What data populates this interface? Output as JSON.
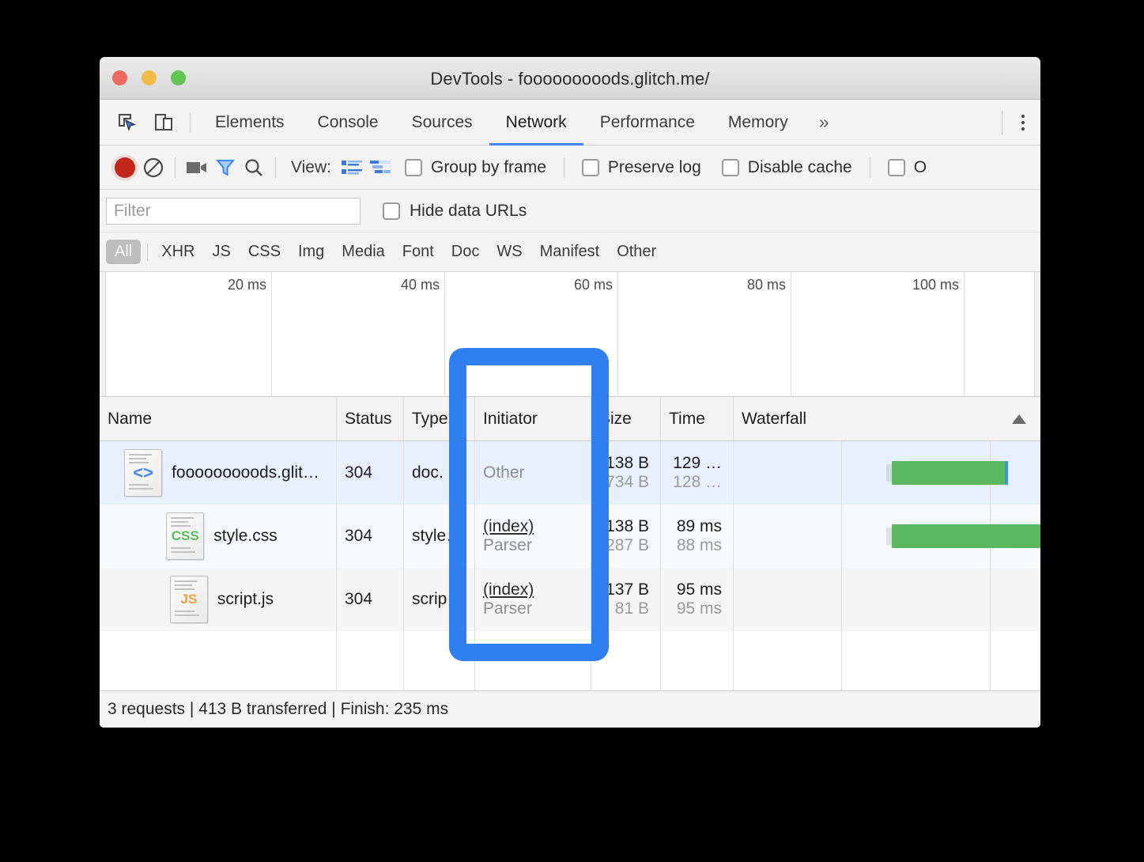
{
  "window": {
    "title": "DevTools - fooooooooods.glitch.me/",
    "traffic_lights": [
      "close",
      "minimize",
      "zoom"
    ]
  },
  "tabbar": {
    "inspect_icon": "inspect-element-icon",
    "device_icon": "device-toolbar-icon",
    "tabs": [
      {
        "label": "Elements",
        "active": false
      },
      {
        "label": "Console",
        "active": false
      },
      {
        "label": "Sources",
        "active": false
      },
      {
        "label": "Network",
        "active": true
      },
      {
        "label": "Performance",
        "active": false
      },
      {
        "label": "Memory",
        "active": false
      }
    ],
    "more_tabs": "»",
    "menu_icon": "kebab-menu-icon"
  },
  "network_toolbar": {
    "record_icon": "record-icon",
    "clear_icon": "clear-icon",
    "camera_icon": "screenshot-camera-icon",
    "filter_icon": "filter-funnel-icon",
    "search_icon": "search-icon",
    "view_label": "View:",
    "view_list_icon": "list-view-icon",
    "view_waterfall_icon": "waterfall-view-icon",
    "checkboxes": [
      {
        "label": "Group by frame",
        "checked": false
      },
      {
        "label": "Preserve log",
        "checked": false
      },
      {
        "label": "Disable cache",
        "checked": false
      },
      {
        "label": "O",
        "checked": false,
        "clipped": true
      }
    ]
  },
  "filter_bar": {
    "placeholder": "Filter",
    "value": "",
    "hide_data_urls_label": "Hide data URLs",
    "hide_data_urls_checked": false
  },
  "type_filters": [
    {
      "label": "All",
      "active": true
    },
    {
      "label": "XHR",
      "active": false
    },
    {
      "label": "JS",
      "active": false
    },
    {
      "label": "CSS",
      "active": false
    },
    {
      "label": "Img",
      "active": false
    },
    {
      "label": "Media",
      "active": false
    },
    {
      "label": "Font",
      "active": false
    },
    {
      "label": "Doc",
      "active": false
    },
    {
      "label": "WS",
      "active": false
    },
    {
      "label": "Manifest",
      "active": false
    },
    {
      "label": "Other",
      "active": false
    }
  ],
  "overview": {
    "ticks": [
      "20 ms",
      "40 ms",
      "60 ms",
      "80 ms",
      "100 ms"
    ]
  },
  "table": {
    "headers": [
      "Name",
      "Status",
      "Type",
      "Initiator",
      "Size",
      "Time",
      "Waterfall"
    ],
    "sort_indicator": "ascending",
    "rows": [
      {
        "icon": "document-code-icon",
        "icon_glyph": "<>",
        "name": "fooooooooods.glit…",
        "status": "304",
        "type": "doc.",
        "initiator_main": "Other",
        "initiator_sub": "",
        "initiator_is_link": false,
        "size_main": "138 B",
        "size_sub": "734 B",
        "time_main": "129 …",
        "time_sub": "128 …",
        "waterfall_start_pct": 51,
        "waterfall_width_pct": 37
      },
      {
        "icon": "document-css-icon",
        "icon_glyph": "CSS",
        "name": "style.css",
        "status": "304",
        "type": "style…",
        "initiator_main": "(index)",
        "initiator_sub": "Parser",
        "initiator_is_link": true,
        "size_main": "138 B",
        "size_sub": "287 B",
        "time_main": "89 ms",
        "time_sub": "88 ms",
        "waterfall_start_pct": 51,
        "waterfall_width_pct": 40
      },
      {
        "icon": "document-js-icon",
        "icon_glyph": "JS",
        "name": "script.js",
        "status": "304",
        "type": "scrip…",
        "initiator_main": "(index)",
        "initiator_sub": "Parser",
        "initiator_is_link": true,
        "size_main": "137 B",
        "size_sub": "81 B",
        "time_main": "95 ms",
        "time_sub": "95 ms",
        "waterfall_start_pct": 0,
        "waterfall_width_pct": 0
      }
    ]
  },
  "status_bar": {
    "text": "3 requests | 413 B transferred | Finish: 235 ms"
  },
  "callout": {
    "target": "initiator-column",
    "color": "#2f7ff0"
  },
  "colors": {
    "accent_blue": "#4285f4",
    "waterfall_green": "#5cb860",
    "highlight_row": "#e8f0fe",
    "record_red": "#c3271c"
  }
}
